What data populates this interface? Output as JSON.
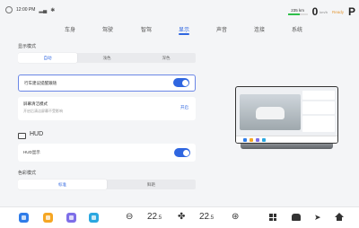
{
  "status": {
    "time": "12:00 PM",
    "battery": "235 km",
    "speed": "0",
    "speed_unit": "km/h",
    "drive_mode": "Ready",
    "gear": "P"
  },
  "tabs": [
    {
      "label": "车身",
      "active": false
    },
    {
      "label": "驾驶",
      "active": false
    },
    {
      "label": "智驾",
      "active": false
    },
    {
      "label": "显示",
      "active": true
    },
    {
      "label": "声音",
      "active": false
    },
    {
      "label": "连接",
      "active": false
    },
    {
      "label": "系统",
      "active": false
    }
  ],
  "display_mode": {
    "title": "显示模式",
    "options": [
      "自动",
      "浅色",
      "深色"
    ],
    "selected": "自动"
  },
  "ambient_toggle": {
    "label": "行车建议提醒跟随",
    "on": true
  },
  "screen_cleaning": {
    "label": "屏幕清洁模式",
    "sub": "开启后清洁屏幕不受影响",
    "action": "开启"
  },
  "hud": {
    "title": "HUD",
    "label": "HUD显示",
    "on": true
  },
  "color_mode": {
    "title": "色彩模式",
    "options": [
      "标准",
      "鲜艳"
    ],
    "selected": "标准"
  },
  "dock": {
    "temp_left": "22",
    "temp_left_dec": ".5",
    "temp_right": "22",
    "temp_right_dec": ".5"
  },
  "colors": {
    "accent": "#2f66e0",
    "app_blue": "#2f7ce8",
    "app_orange": "#f5a623",
    "app_purple": "#7d6ee8",
    "app_teal": "#2aa7e0"
  }
}
